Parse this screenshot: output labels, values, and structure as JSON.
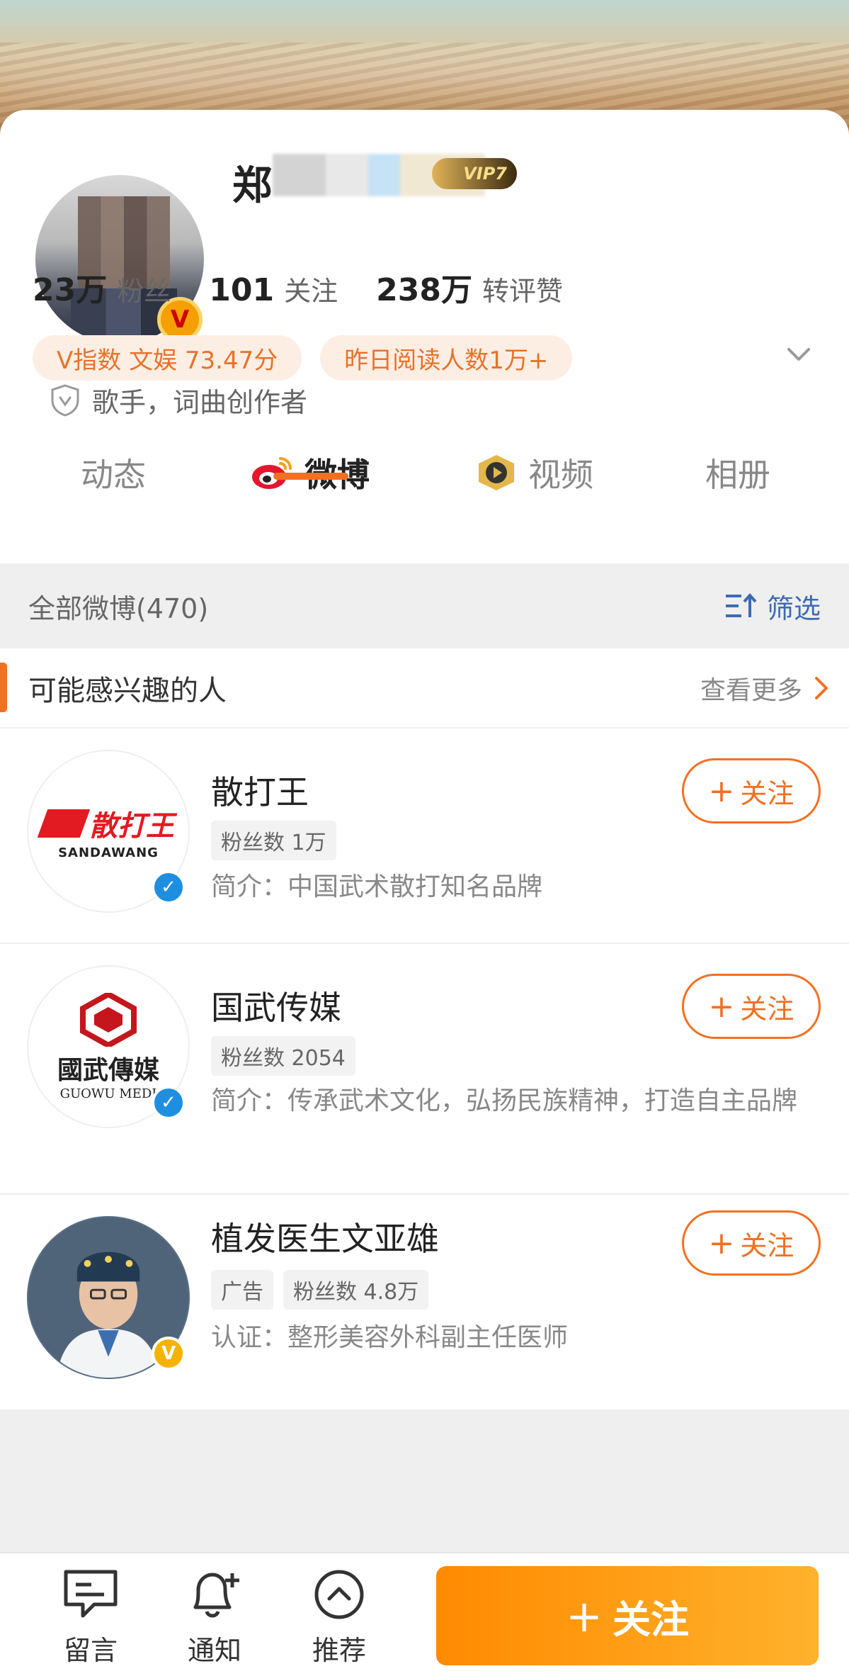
{
  "profile": {
    "name": "郑",
    "vip": "VIP7",
    "stats": [
      {
        "num": "23万",
        "label": "粉丝"
      },
      {
        "num": "101",
        "label": "关注"
      },
      {
        "num": "238万",
        "label": "转评赞"
      }
    ],
    "tags": [
      "V指数 文娱 73.47分",
      "昨日阅读人数1万+"
    ],
    "role": "歌手，词曲创作者"
  },
  "tabs": [
    {
      "label": "动态",
      "icon": ""
    },
    {
      "label": "微博",
      "icon": "weibo-icon"
    },
    {
      "label": "视频",
      "icon": "video-icon"
    },
    {
      "label": "相册",
      "icon": ""
    }
  ],
  "filterbar": {
    "count": "全部微博(470)",
    "filter": "筛选"
  },
  "suggest": {
    "title": "可能感兴趣的人",
    "more": "查看更多",
    "follow_label": "关注",
    "people": [
      {
        "name": "散打王",
        "chips": [
          "粉丝数 1万"
        ],
        "desc": "简介：中国武术散打知名品牌",
        "logo_text": "散打王",
        "logo_sub": "SANDAWANG",
        "badge_color": "#1e8fe0"
      },
      {
        "name": "国武传媒",
        "chips": [
          "粉丝数 2054"
        ],
        "desc": "简介：传承武术文化，弘扬民族精神，打造自主品牌",
        "logo_text": "國武傳媒",
        "logo_sub": "GUOWU MEDI",
        "badge_color": "#1e8fe0"
      },
      {
        "name": "植发医生文亚雄",
        "chips": [
          "广告",
          "粉丝数 4.8万"
        ],
        "desc": "认证：整形美容外科副主任医师",
        "logo_text": "",
        "logo_sub": "",
        "badge_color": "#f5b300"
      }
    ]
  },
  "bottom": {
    "items": [
      {
        "label": "留言",
        "icon": "message-icon"
      },
      {
        "label": "通知",
        "icon": "bell-plus-icon"
      },
      {
        "label": "推荐",
        "icon": "chevron-up-circle-icon"
      }
    ],
    "follow": "关注"
  }
}
